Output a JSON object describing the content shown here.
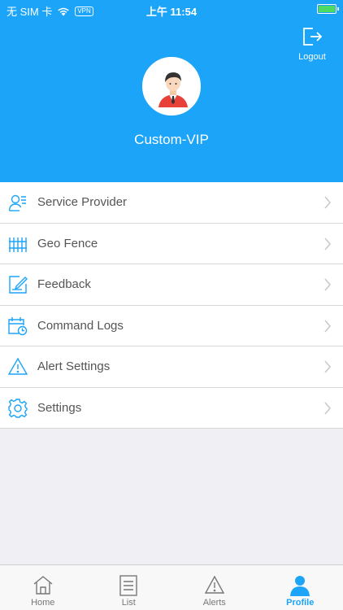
{
  "status": {
    "carrier": "无 SIM 卡",
    "vpn": "VPN",
    "time": "上午 11:54"
  },
  "header": {
    "logout_label": "Logout",
    "username": "Custom-VIP"
  },
  "menu": {
    "items": [
      {
        "label": "Service Provider",
        "icon": "user-id-icon"
      },
      {
        "label": "Geo Fence",
        "icon": "fence-icon"
      },
      {
        "label": "Feedback",
        "icon": "feedback-icon"
      },
      {
        "label": "Command Logs",
        "icon": "calendar-clock-icon"
      },
      {
        "label": "Alert Settings",
        "icon": "warning-icon"
      },
      {
        "label": "Settings",
        "icon": "gear-icon"
      }
    ]
  },
  "tabs": [
    {
      "label": "Home",
      "icon": "home-icon",
      "active": false
    },
    {
      "label": "List",
      "icon": "list-icon",
      "active": false
    },
    {
      "label": "Alerts",
      "icon": "alert-icon",
      "active": false
    },
    {
      "label": "Profile",
      "icon": "profile-icon",
      "active": true
    }
  ],
  "colors": {
    "accent": "#1ba4f8",
    "background": "#efeff4",
    "battery": "#4cd964"
  }
}
